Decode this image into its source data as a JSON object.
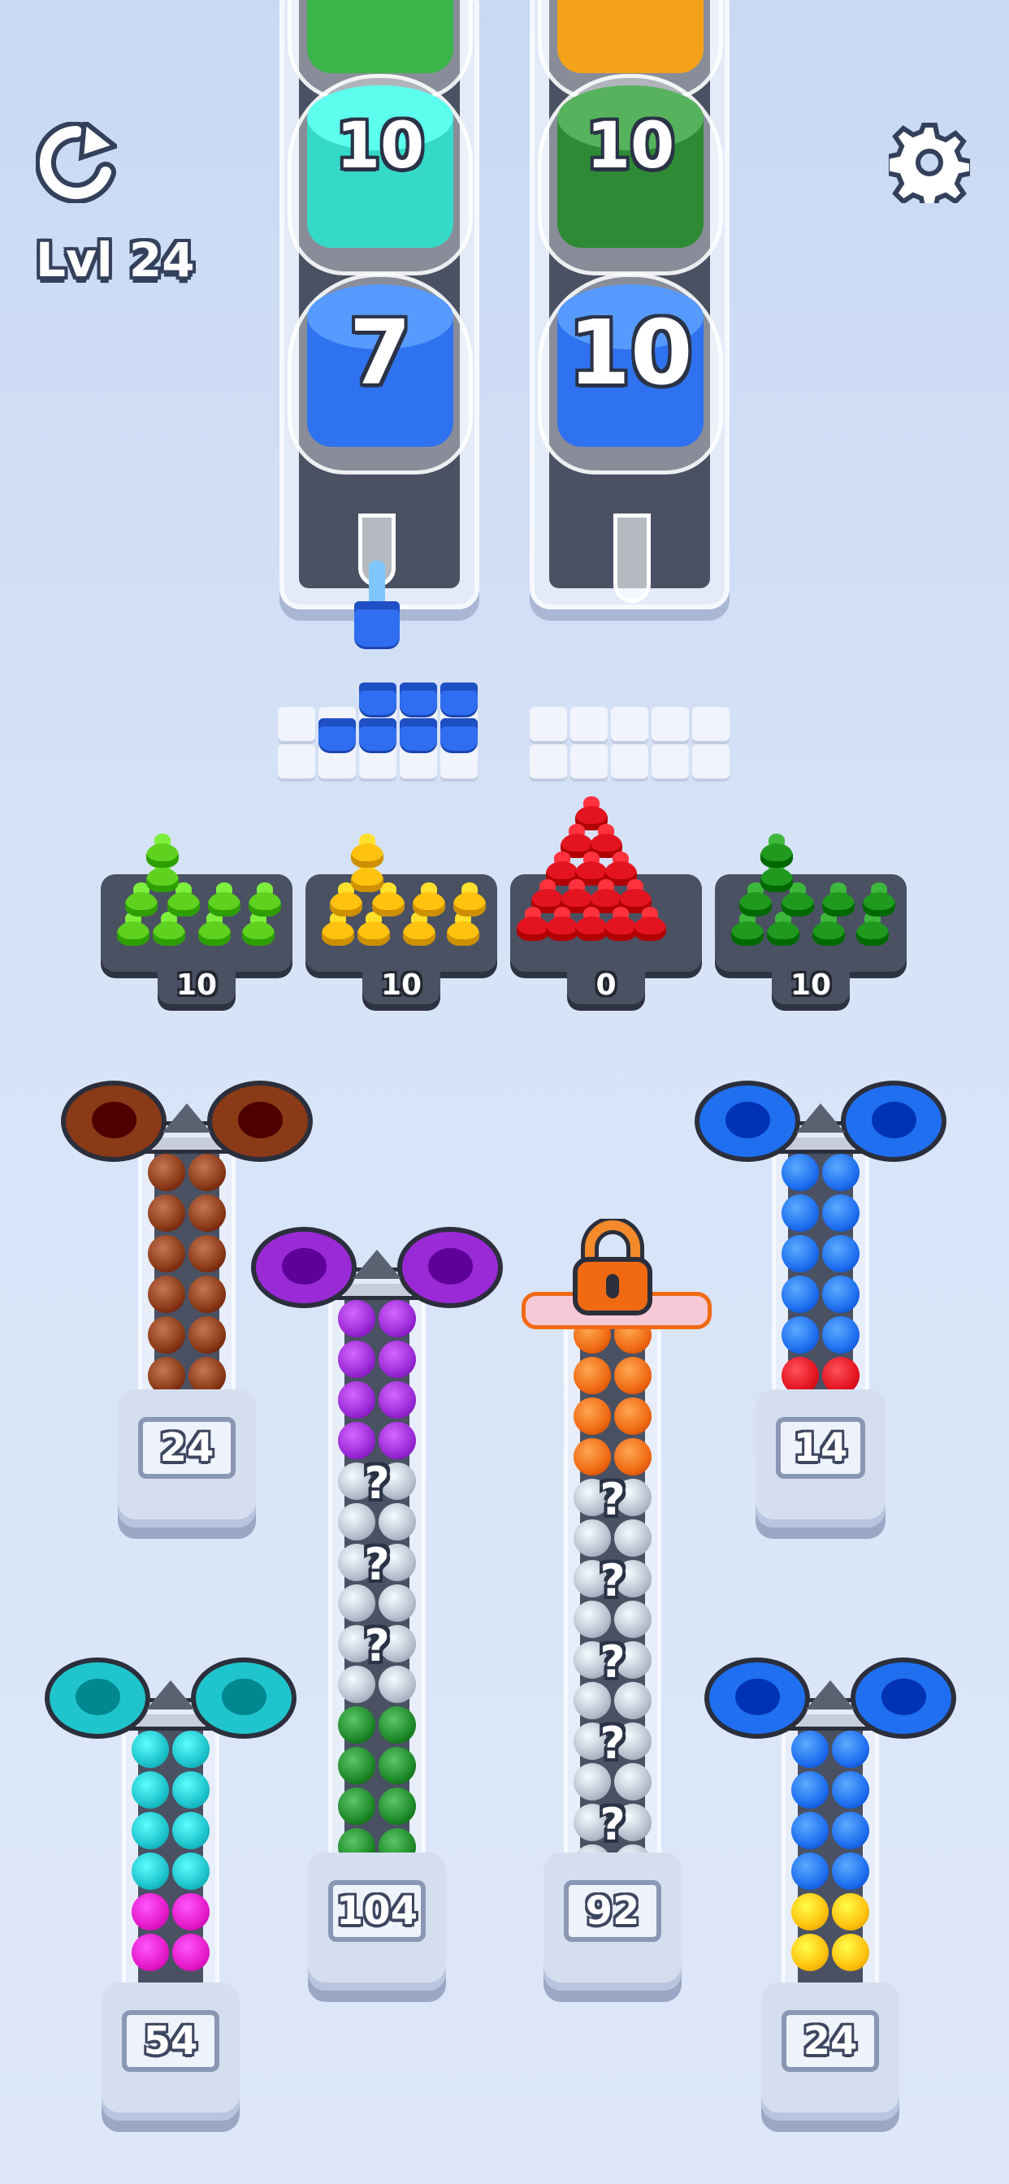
{
  "hud": {
    "level_label": "Lvl 24"
  },
  "cups_left": [
    {
      "color": "#3bb54a",
      "label": ""
    },
    {
      "color": "#35d9c7",
      "label": "10"
    },
    {
      "color": "#2f72ef",
      "label": "7"
    }
  ],
  "cups_right": [
    {
      "color": "#f5a21a",
      "label": ""
    },
    {
      "color": "#2f8a35",
      "label": "10"
    },
    {
      "color": "#2f72ef",
      "label": "10"
    }
  ],
  "trays": [
    {
      "color": "#5fd11f",
      "count": "10"
    },
    {
      "color": "#ffc20e",
      "count": "10"
    },
    {
      "color": "#e3141f",
      "count": "0"
    },
    {
      "color": "#1f9a1f",
      "count": "10"
    }
  ],
  "lanes": [
    {
      "count": "24",
      "ring_color": "#8a3a17"
    },
    {
      "count": "104",
      "ring_color": "#9a2ad6"
    },
    {
      "count": "92",
      "ring_color": "#f06a14"
    },
    {
      "count": "14",
      "ring_color": "#1f6ff0"
    },
    {
      "count": "54",
      "ring_color": "#1fc4cc"
    },
    {
      "count": "24",
      "ring_color": "#1f6ff0"
    }
  ],
  "question_mark": "?"
}
